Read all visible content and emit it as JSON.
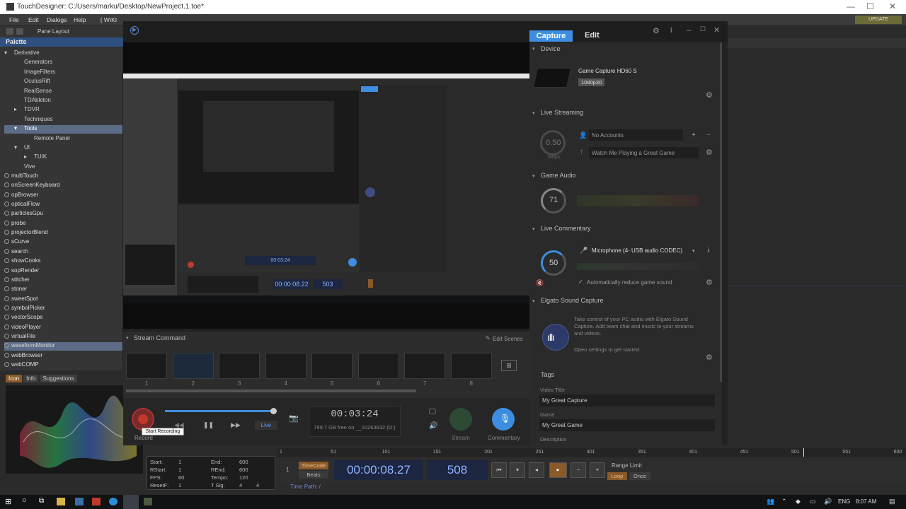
{
  "window": {
    "title": "TouchDesigner: C:/Users/marku/Desktop/NewProject.1.toe*"
  },
  "menu": {
    "items": [
      "File",
      "Edit",
      "Dialogs",
      "Help"
    ],
    "wiki": "[ WIKI"
  },
  "toolbar": {
    "pane_layout": "Pane Layout"
  },
  "palette": {
    "title": "Palette",
    "tree": [
      {
        "label": "Derivative",
        "depth": 0,
        "caret": "▾"
      },
      {
        "label": "Generators",
        "depth": 1,
        "caret": ""
      },
      {
        "label": "ImageFilters",
        "depth": 1,
        "caret": ""
      },
      {
        "label": "OculusRift",
        "depth": 1,
        "caret": ""
      },
      {
        "label": "RealSense",
        "depth": 1,
        "caret": ""
      },
      {
        "label": "TDAbleton",
        "depth": 1,
        "caret": ""
      },
      {
        "label": "TDVR",
        "depth": 1,
        "caret": "▸"
      },
      {
        "label": "Techniques",
        "depth": 1,
        "caret": ""
      },
      {
        "label": "Tools",
        "depth": 1,
        "caret": "▾"
      },
      {
        "label": "Remote Panel",
        "depth": 2,
        "caret": ""
      },
      {
        "label": "UI",
        "depth": 1,
        "caret": "▾"
      },
      {
        "label": "TUIK",
        "depth": 2,
        "caret": "▸"
      },
      {
        "label": "Vive",
        "depth": 1,
        "caret": ""
      }
    ],
    "ops": [
      "multiTouch",
      "onScreenKeyboard",
      "opBrowser",
      "opticalFlow",
      "particlesGpu",
      "probe",
      "projectorBlend",
      "sCurve",
      "search",
      "showCooks",
      "sopRender",
      "stitcher",
      "stoner",
      "sweetSpot",
      "symbolPicker",
      "vectorScope",
      "videoPlayer",
      "virtualFile",
      "waveformMonitor",
      "webBrowser",
      "webCOMP"
    ],
    "selected_op": "waveformMonitor",
    "tabs": [
      "Icon",
      "Info",
      "Suggestions"
    ]
  },
  "stats": {
    "start_label": "Start:",
    "start": "1",
    "end_label": "End:",
    "end": "600",
    "rstart_label": "RStart:",
    "rstart": "1",
    "rend_label": "REnd:",
    "rend": "600",
    "fps_label": "FPS:",
    "fps": "60",
    "tempo_label": "Tempo:",
    "tempo": "120",
    "resetf_label": "ResetF:",
    "resetf": "1",
    "tsig_label": "T Sig:",
    "tsig_a": "4",
    "tsig_b": "4"
  },
  "timeline": {
    "ticks": [
      "1",
      "51",
      "101",
      "151",
      "201",
      "251",
      "301",
      "351",
      "401",
      "451",
      "501",
      "551",
      "600"
    ],
    "timecode_label": "TimeCode",
    "beats_label": "Beats",
    "timecode": "00:00:08.27",
    "frame": "508",
    "range_limit": "Range Limit",
    "loop": "Loop",
    "once": "Once",
    "time_path": "Time Path: /",
    "update": "UPDATE"
  },
  "elgato": {
    "tab_capture": "Capture",
    "tab_edit": "Edit",
    "device_head": "Device",
    "device_name": "Game Capture HD60 S",
    "device_badge": "1080p30",
    "live_head": "Live Streaming",
    "mbps_value": "0.50",
    "mbps_unit": "Mbps",
    "accounts": "No Accounts",
    "stream_title": "Watch Me Playing a Great Game",
    "game_audio_head": "Game Audio",
    "game_audio_value": "71",
    "commentary_head": "Live Commentary",
    "commentary_value": "50",
    "mic": "Microphone (4- USB audio CODEC)",
    "auto_reduce": "Automatically reduce game sound",
    "sound_capture_head": "Elgato Sound Capture",
    "sound_capture_text": "Take control of your PC audio with Elgato Sound Capture. Add team chat and music to your streams and videos.",
    "sound_capture_link": "Open settings to get started.",
    "tags_head": "Tags",
    "video_title_label": "Video Title",
    "video_title": "My Great Capture",
    "game_label": "Game",
    "game": "My Great Game",
    "description_label": "Description",
    "stream_command": "Stream Command",
    "edit_scenes": "Edit Scenes",
    "scenes": [
      "1",
      "2",
      "3",
      "4",
      "5",
      "6",
      "7",
      "8"
    ],
    "record_time": "00:03:24",
    "free_space": "799.7 GB free on __10263832 (D:)",
    "live_label": "Live",
    "record_label": "Record",
    "tooltip": "Start Recording",
    "stream_label": "Stream",
    "commentary_label": "Commentary",
    "progress": 0.98
  },
  "nested": {
    "timecode": "00:00:08.22",
    "frame": "503",
    "record_time": "00:03:24"
  },
  "taskbar": {
    "lang": "ENG",
    "time": "8:07 AM"
  },
  "colors": {
    "accent": "#3d8ee0",
    "record": "#c0392b",
    "palette_head": "#2e4f7f"
  }
}
